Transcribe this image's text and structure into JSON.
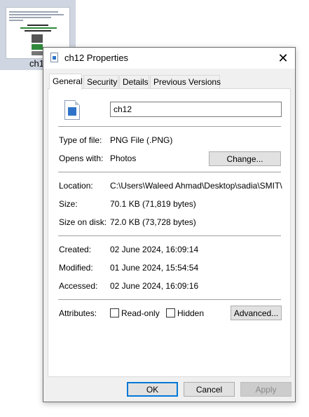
{
  "desktop": {
    "icon_label": "ch1"
  },
  "window": {
    "title": "ch12 Properties"
  },
  "tabs": [
    {
      "label": "General"
    },
    {
      "label": "Security"
    },
    {
      "label": "Details"
    },
    {
      "label": "Previous Versions"
    }
  ],
  "general": {
    "file_name": "ch12",
    "rows": {
      "type_label": "Type of file:",
      "type_value": "PNG File (.PNG)",
      "opens_label": "Opens with:",
      "opens_value": "Photos",
      "location_label": "Location:",
      "location_value": "C:\\Users\\Waleed Ahmad\\Desktop\\sadia\\SMIT\\class",
      "size_label": "Size:",
      "size_value": "70.1 KB (71,819 bytes)",
      "disk_label": "Size on disk:",
      "disk_value": "72.0 KB (73,728 bytes)",
      "created_label": "Created:",
      "created_value": "02 June 2024, 16:09:14",
      "modified_label": "Modified:",
      "modified_value": "01 June 2024, 15:54:54",
      "accessed_label": "Accessed:",
      "accessed_value": "02 June 2024, 16:09:16",
      "attributes_label": "Attributes:"
    },
    "change_button": "Change...",
    "readonly_label": "Read-only",
    "hidden_label": "Hidden",
    "advanced_button": "Advanced..."
  },
  "footer": {
    "ok": "OK",
    "cancel": "Cancel",
    "apply": "Apply"
  }
}
